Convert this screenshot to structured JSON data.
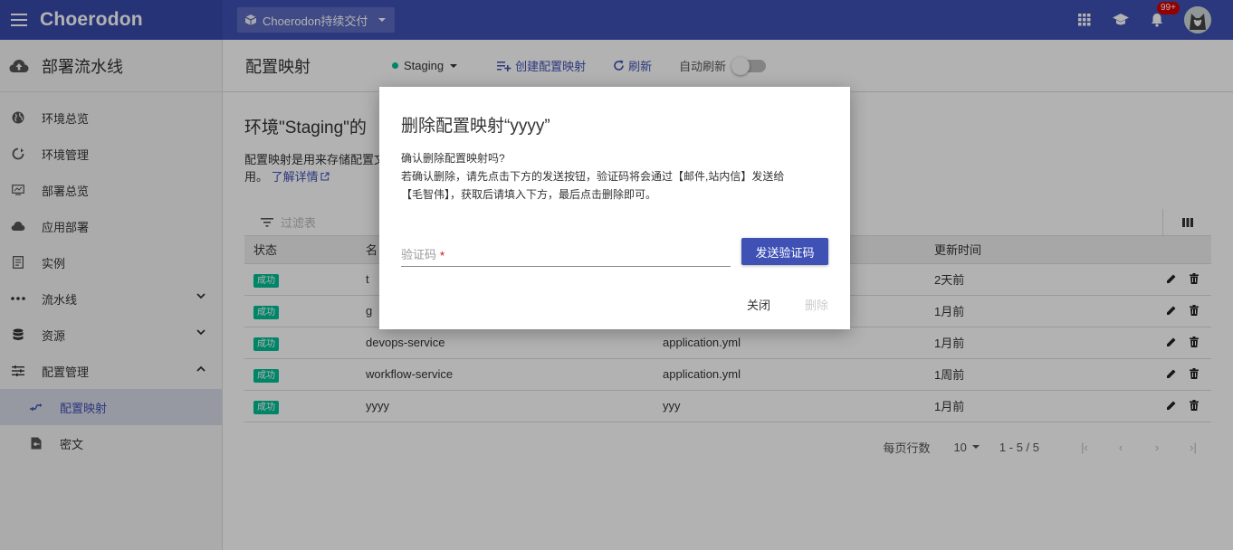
{
  "header": {
    "brand": "Choerodon",
    "project": "Choerodon持续交付",
    "notification_badge": "99+"
  },
  "sidebar": {
    "title": "部署流水线",
    "items": [
      {
        "label": "环境总览",
        "icon": "globe-icon"
      },
      {
        "label": "环境管理",
        "icon": "cycle-icon"
      },
      {
        "label": "部署总览",
        "icon": "monitor-icon"
      },
      {
        "label": "应用部署",
        "icon": "cloud-icon"
      },
      {
        "label": "实例",
        "icon": "document-icon"
      },
      {
        "label": "流水线",
        "icon": "dots-icon"
      },
      {
        "label": "资源",
        "icon": "database-icon"
      },
      {
        "label": "配置管理",
        "icon": "sliders-icon"
      },
      {
        "label": "配置映射",
        "icon": "shuffle-icon"
      },
      {
        "label": "密文",
        "icon": "key-file-icon"
      }
    ]
  },
  "toolbar": {
    "title": "配置映射",
    "env": "Staging",
    "create": "创建配置映射",
    "refresh": "刷新",
    "auto_refresh": "自动刷新"
  },
  "content": {
    "env_title": "环境\"Staging\"的",
    "desc_line1": "配置映射是用来存储配置文",
    "desc_line2": "用。",
    "learn_more": "了解详情",
    "filter_placeholder": "过滤表"
  },
  "table": {
    "headers": [
      "状态",
      "名",
      "",
      "更新时间"
    ],
    "rows": [
      {
        "status": "成功",
        "name": "t",
        "key": "",
        "time": "2天前"
      },
      {
        "status": "成功",
        "name": "g",
        "key": "",
        "time": "1月前"
      },
      {
        "status": "成功",
        "name": "devops-service",
        "key": "application.yml",
        "time": "1月前"
      },
      {
        "status": "成功",
        "name": "workflow-service",
        "key": "application.yml",
        "time": "1周前"
      },
      {
        "status": "成功",
        "name": "yyyy",
        "key": "yyy",
        "time": "1月前"
      }
    ]
  },
  "pager": {
    "rows_label": "每页行数",
    "size": "10",
    "range": "1 - 5 / 5"
  },
  "modal": {
    "title": "删除配置映射“yyyy”",
    "line1": "确认删除配置映射吗?",
    "line2": "若确认删除，请先点击下方的发送按钮，验证码将会通过【邮件,站内信】发送给",
    "line3": "【毛智伟】，获取后请填入下方，最后点击删除即可。",
    "code_placeholder": "验证码",
    "required_mark": "*",
    "send": "发送验证码",
    "close": "关闭",
    "delete": "删除"
  },
  "colors": {
    "primary": "#3f51b5",
    "success": "#00bf96"
  }
}
